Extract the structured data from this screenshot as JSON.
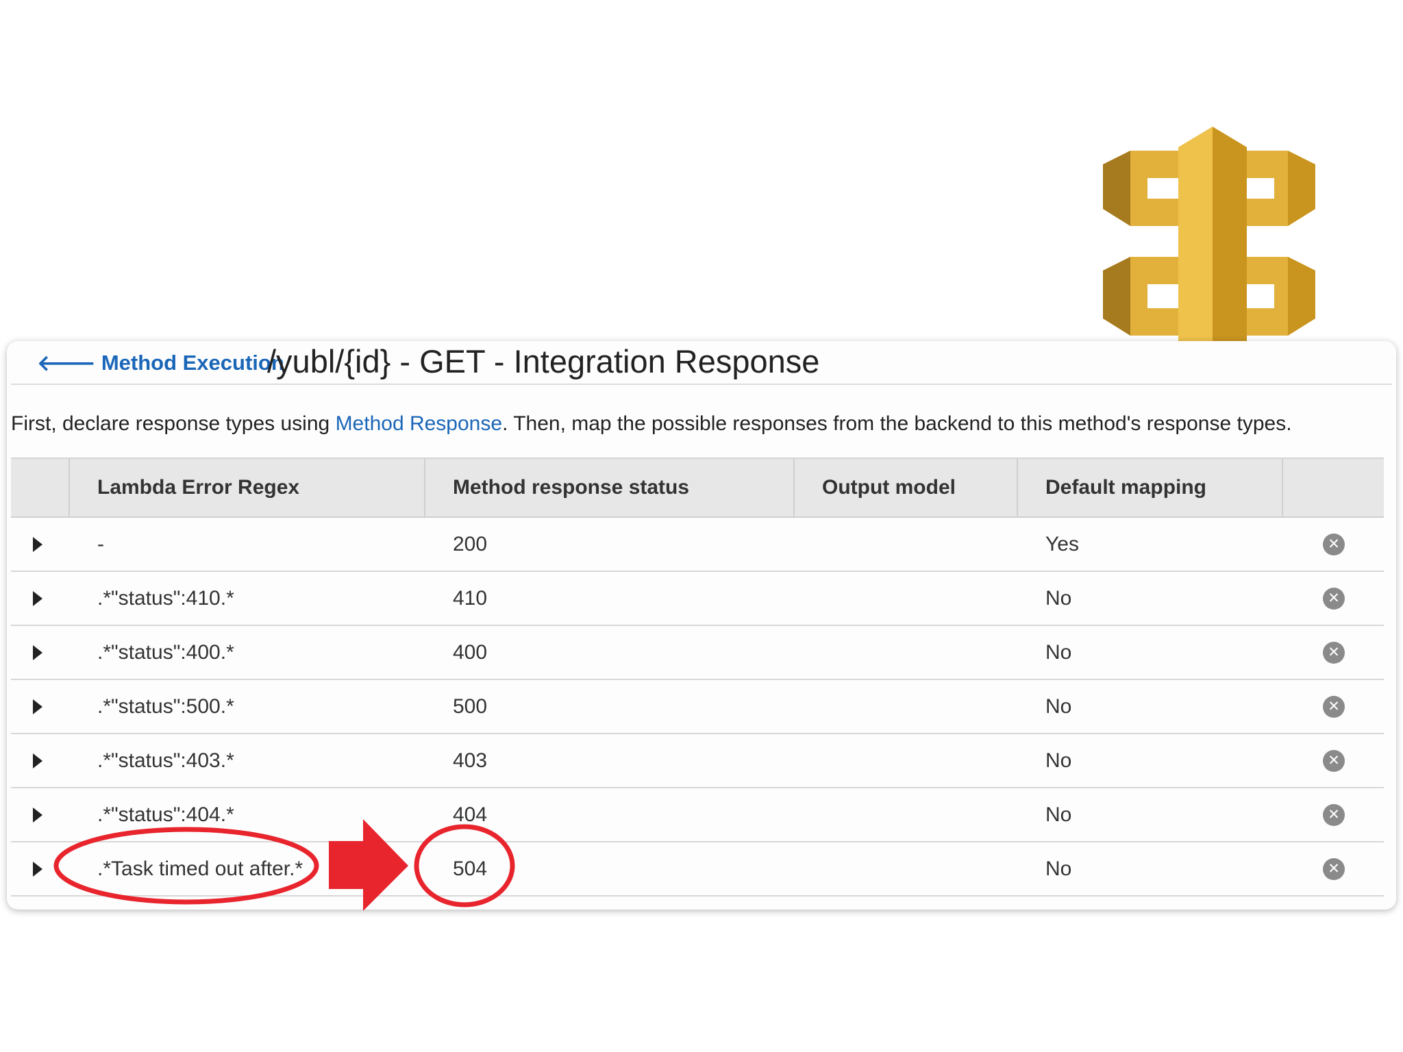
{
  "header": {
    "back_label": "Method Execution",
    "back_icon": "arrow-left-icon",
    "title": "/yubl/{id} - GET - Integration Response"
  },
  "description": {
    "before": "First, declare response types using ",
    "link": "Method Response",
    "after": ". Then, map the possible responses from the backend to this method's response types."
  },
  "table": {
    "columns": [
      "Lambda Error Regex",
      "Method response status",
      "Output model",
      "Default mapping"
    ],
    "rows": [
      {
        "regex": "-",
        "status": "200",
        "model": "",
        "default": "Yes"
      },
      {
        "regex": ".*\"status\":410.*",
        "status": "410",
        "model": "",
        "default": "No"
      },
      {
        "regex": ".*\"status\":400.*",
        "status": "400",
        "model": "",
        "default": "No"
      },
      {
        "regex": ".*\"status\":500.*",
        "status": "500",
        "model": "",
        "default": "No"
      },
      {
        "regex": ".*\"status\":403.*",
        "status": "403",
        "model": "",
        "default": "No"
      },
      {
        "regex": ".*\"status\":404.*",
        "status": "404",
        "model": "",
        "default": "No"
      },
      {
        "regex": ".*Task timed out after.*",
        "status": "504",
        "model": "",
        "default": "No"
      }
    ],
    "expand_icon": "caret-right-icon",
    "delete_icon": "remove-circle-icon",
    "delete_glyph": "✕"
  },
  "colors": {
    "link": "#1a66b8",
    "annotation": "#e8242d",
    "logo_light": "#e2b13c",
    "logo_dark": "#a67a1e"
  },
  "annotations": {
    "highlighted_row": 6,
    "marks": [
      "ellipse-regex",
      "arrow-right",
      "ellipse-status"
    ]
  },
  "logo": {
    "icon": "api-gateway-logo"
  }
}
